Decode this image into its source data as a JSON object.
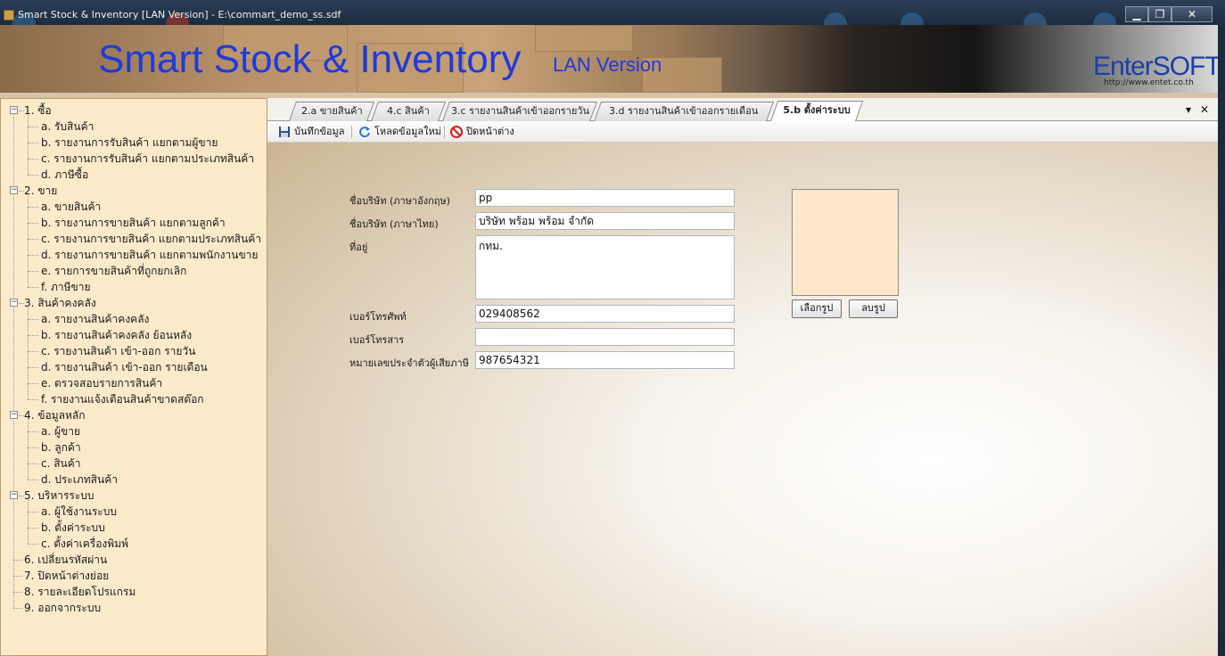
{
  "window": {
    "title": "Smart Stock & Inventory [LAN Version] - E:\\commart_demo_ss.sdf",
    "minimize_label": "▁",
    "restore_label": "❐",
    "close_label": "✕"
  },
  "banner": {
    "brand": "Smart Stock & Inventory",
    "edition": "LAN Version",
    "company": "EnterSOFT",
    "url": "http://www.entet.co.th"
  },
  "tree": {
    "groups": [
      {
        "label": "1. ซื้อ",
        "items": [
          "a. รับสินค้า",
          "b. รายงานการรับสินค้า แยกตามผู้ขาย",
          "c. รายงานการรับสินค้า แยกตามประเภทสินค้า",
          "d. ภาษีซื้อ"
        ]
      },
      {
        "label": "2. ขาย",
        "items": [
          "a. ขายสินค้า",
          "b. รายงานการขายสินค้า แยกตามลูกค้า",
          "c. รายงานการขายสินค้า แยกตามประเภทสินค้า",
          "d. รายงานการขายสินค้า แยกตามพนักงานขาย",
          "e. รายการขายสินค้าที่ถูกยกเลิก",
          "f. ภาษีขาย"
        ]
      },
      {
        "label": "3. สินค้าคงคลัง",
        "items": [
          "a. รายงานสินค้าคงคลัง",
          "b. รายงานสินค้าคงคลัง ย้อนหลัง",
          "c. รายงานสินค้า เข้า-ออก รายวัน",
          "d. รายงานสินค้า เข้า-ออก รายเดือน",
          "e. ตรวจสอบรายการสินค้า",
          "f. รายงานแจ้งเตือนสินค้าขาดสต๊อก"
        ]
      },
      {
        "label": "4. ข้อมูลหลัก",
        "items": [
          "a. ผู้ขาย",
          "b. ลูกค้า",
          "c. สินค้า",
          "d. ประเภทสินค้า"
        ]
      },
      {
        "label": "5. บริหารระบบ",
        "items": [
          "a. ผู้ใช้งานระบบ",
          "b. ตั้งค่าระบบ",
          "c. ตั้งค่าเครื่องพิมพ์"
        ]
      }
    ],
    "leaves": [
      "6. เปลี่ยนรหัสผ่าน",
      "7. ปิดหน้าต่างย่อย",
      "8. รายละเอียดโปรแกรม",
      "9. ออกจากระบบ"
    ]
  },
  "tabs": [
    {
      "label": "2.a ขายสินค้า",
      "active": false
    },
    {
      "label": "4.c สินค้า",
      "active": false
    },
    {
      "label": "3.c รายงานสินค้าเข้าออกรายวัน",
      "active": false
    },
    {
      "label": "3.d รายงานสินค้าเข้าออกรายเดือน",
      "active": false
    },
    {
      "label": "5.b ตั้งค่าระบบ",
      "active": true
    }
  ],
  "tab_controls": {
    "dropdown": "▾",
    "close": "✕"
  },
  "toolbar": {
    "save": "บันทึกข้อมูล",
    "reload": "โหลดข้อมูลใหม่",
    "close": "ปิดหน้าต่าง"
  },
  "form": {
    "company_en_label": "ชื่อบริษัท (ภาษาอังกฤษ)",
    "company_en_value": "pp",
    "company_th_label": "ชื่อบริษัท (ภาษาไทย)",
    "company_th_value": "บริษัท พร้อม พร้อม จำกัด",
    "address_label": "ที่อยู่",
    "address_value": "กทม.",
    "phone_label": "เบอร์โทรศัพท์",
    "phone_value": "029408562",
    "fax_label": "เบอร์โทรสาร",
    "fax_value": "",
    "taxid_label": "หมายเลขประจำตัวผู้เสียภาษี",
    "taxid_value": "987654321"
  },
  "photo": {
    "choose_label": "เลือกรูป",
    "delete_label": "ลบรูป"
  },
  "colors": {
    "tree_bg": "#fdeacb",
    "photo_bg": "#ffe8c9",
    "brand_blue": "#1f3bd8"
  }
}
